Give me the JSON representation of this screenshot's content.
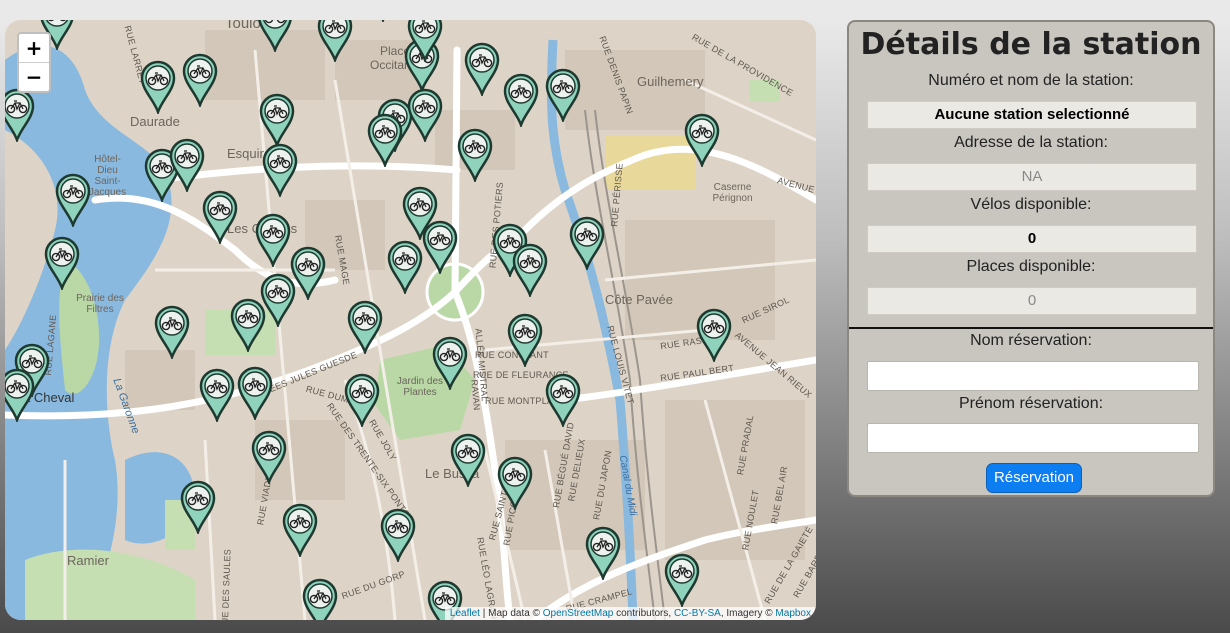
{
  "map": {
    "zoom_in_label": "+",
    "zoom_out_label": "−",
    "attribution": {
      "leaflet": "Leaflet",
      "text1": " | Map data © ",
      "osm": "OpenStreetMap",
      "text2": " contributors, ",
      "license": "CC-BY-SA",
      "text3": ", Imagery © ",
      "mapbox": "Mapbox"
    },
    "labels": {
      "toulouse": "Toulouse",
      "place_occitanie": "Place Occitanie",
      "guilhemery": "Guilhemery",
      "daurade": "Daurade",
      "esquirol": "Esquirol",
      "hotel_dieu": "Hôtel-Dieu Saint-Jacques",
      "les_carmes": "Les Carmes",
      "caserne": "Caserne Pérignon",
      "cote_pavee": "Côte Pavée",
      "prairie": "Prairie des Filtres",
      "jardin": "Jardin des Plantes",
      "le_busca": "Le Busca",
      "la_garonne": "La Garonne",
      "canal": "Canal du Midi",
      "ramier": "Ramier",
      "cheval": "ier à Cheval",
      "allees_guesde": "ALLÉES JULES GUESDE",
      "rue_larrey": "RUE LARREY",
      "rue_denis_papin": "RUE DENIS PAPIN",
      "rue_providence": "RUE DE LA PROVIDENCE",
      "rue_potiers": "RUE DES POTIERS",
      "rue_perisse": "RUE PÉRISSE",
      "rue_constant": "RUE CONSTANT",
      "rue_fleurance": "RUE DE FLEURANCE",
      "rue_montplaisir": "RUE MONTPLAISIR",
      "rue_raspail": "RUE RASPAIL",
      "rue_paul_bert": "RUE PAUL BERT",
      "avenue_jean_rieux": "AVENUE JEAN RIEUX",
      "rue_sirol": "RUE SIROL",
      "rue_louis_vitet": "RUE LOUIS VITET",
      "rue_dumeril": "RUE DUMERIL",
      "rue_trente_six_ponts": "RUE DES TRENTE-SIX PONTS",
      "rue_joly": "RUE JOLY",
      "rue_viadieu": "RUE VIADIEU",
      "rue_saint_luc": "RUE SAINT-LUC",
      "rue_picot": "RUE PICOT",
      "rue_begue_david": "RUE BÉGUÉ DAVID",
      "rue_delieux": "RUE DELIEUX",
      "rue_japon": "RUE DU JAPON",
      "rue_pradal": "RUE PRADAL",
      "rue_bel_air": "RUE BEL AIR",
      "rue_noulet": "RUE NOULET",
      "rue_gaiete": "RUE DE LA GAIETÉ",
      "rue_barrau": "RUE BARRAU",
      "rue_crampel": "RUE CRAMPEL",
      "rue_gorp": "RUE DU GORP",
      "rue_saules": "RUE DES SAULES",
      "rue_lagane": "RUE LAGANE",
      "rue_leo_lagrange": "RUE LÉO LAGRANGE",
      "rue_mage": "RUE MAGE",
      "allee_mistral": "ALLÉE MISTRAL",
      "rue_ravan": "RAVAN",
      "avenue": "AVENUE"
    },
    "marker_count": 62
  },
  "panel": {
    "title": "Détails de la station",
    "station_label": "Numéro et nom de la station:",
    "station_value": "Aucune station selectionné",
    "address_label": "Adresse de la station:",
    "address_value": "NA",
    "bikes_label": "Vélos disponible:",
    "bikes_value": "0",
    "places_label": "Places disponible:",
    "places_value": "0",
    "lastname_label": "Nom réservation:",
    "lastname_value": "",
    "firstname_label": "Prénom réservation:",
    "firstname_value": "",
    "reserve_button": "Réservation"
  },
  "colors": {
    "marker_fill": "#8fd3bd",
    "marker_stroke": "#1e3a30",
    "button": "#0d7ef2",
    "water": "#8ab9df",
    "park": "#b9d8a6"
  },
  "icons": [
    "bicycle-icon",
    "plus-icon",
    "minus-icon"
  ]
}
